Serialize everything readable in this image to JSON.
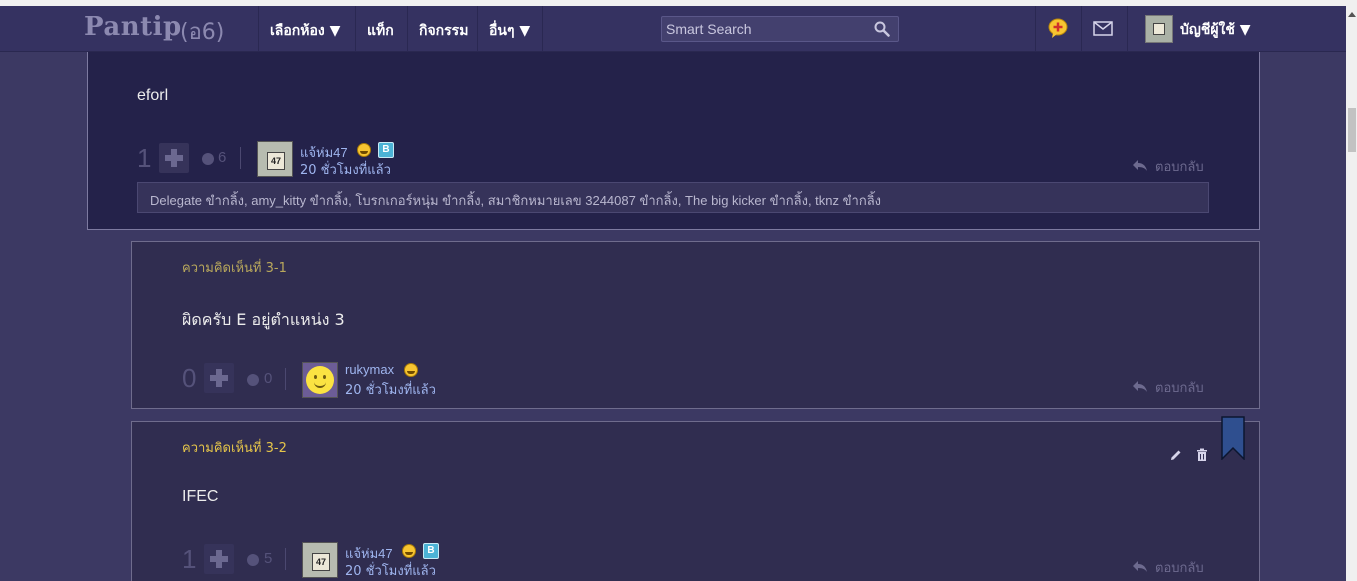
{
  "navbar": {
    "logo_text": "Pantip",
    "logo_mark": "(อ6)",
    "items": [
      "เลือกห้อง ▼",
      "แท็ก",
      "กิจกรรม",
      "อื่นๆ ▼"
    ],
    "search_placeholder": "Smart Search",
    "account_label": "บัญชีผู้ใช้ ▼",
    "icons": [
      "new-topic-icon",
      "mail-icon",
      "search-icon"
    ]
  },
  "main_comment": {
    "body": "eforl",
    "votes": "1",
    "emotions_count": "6",
    "username": "แจ้ห่ม47",
    "timestamp": "20 ชั่วโมงที่แล้ว",
    "plate_number": "47",
    "badge_b": "B",
    "reply_label": "ตอบกลับ",
    "emotion_list": "Delegate ขำกลิ้ง, amy_kitty ขำกลิ้ง, โบรกเกอร์หนุ่ม ขำกลิ้ง, สมาชิกหมายเลข 3244087 ขำกลิ้ง, The big kicker ขำกลิ้ง, tknz ขำกลิ้ง"
  },
  "replies": [
    {
      "label": "ความคิดเห็นที่ 3-1",
      "body": "ผิดครับ E อยู่ตำแหน่ง 3",
      "votes": "0",
      "emotions_count": "0",
      "username": "rukymax",
      "timestamp": "20 ชั่วโมงที่แล้ว",
      "reply_label": "ตอบกลับ"
    },
    {
      "label": "ความคิดเห็นที่ 3-2",
      "body": "IFEC",
      "votes": "1",
      "emotions_count": "5",
      "username": "แจ้ห่ม47",
      "timestamp": "20 ชั่วโมงที่แล้ว",
      "plate_number": "47",
      "badge_b": "B",
      "reply_label": "ตอบกลับ"
    }
  ]
}
